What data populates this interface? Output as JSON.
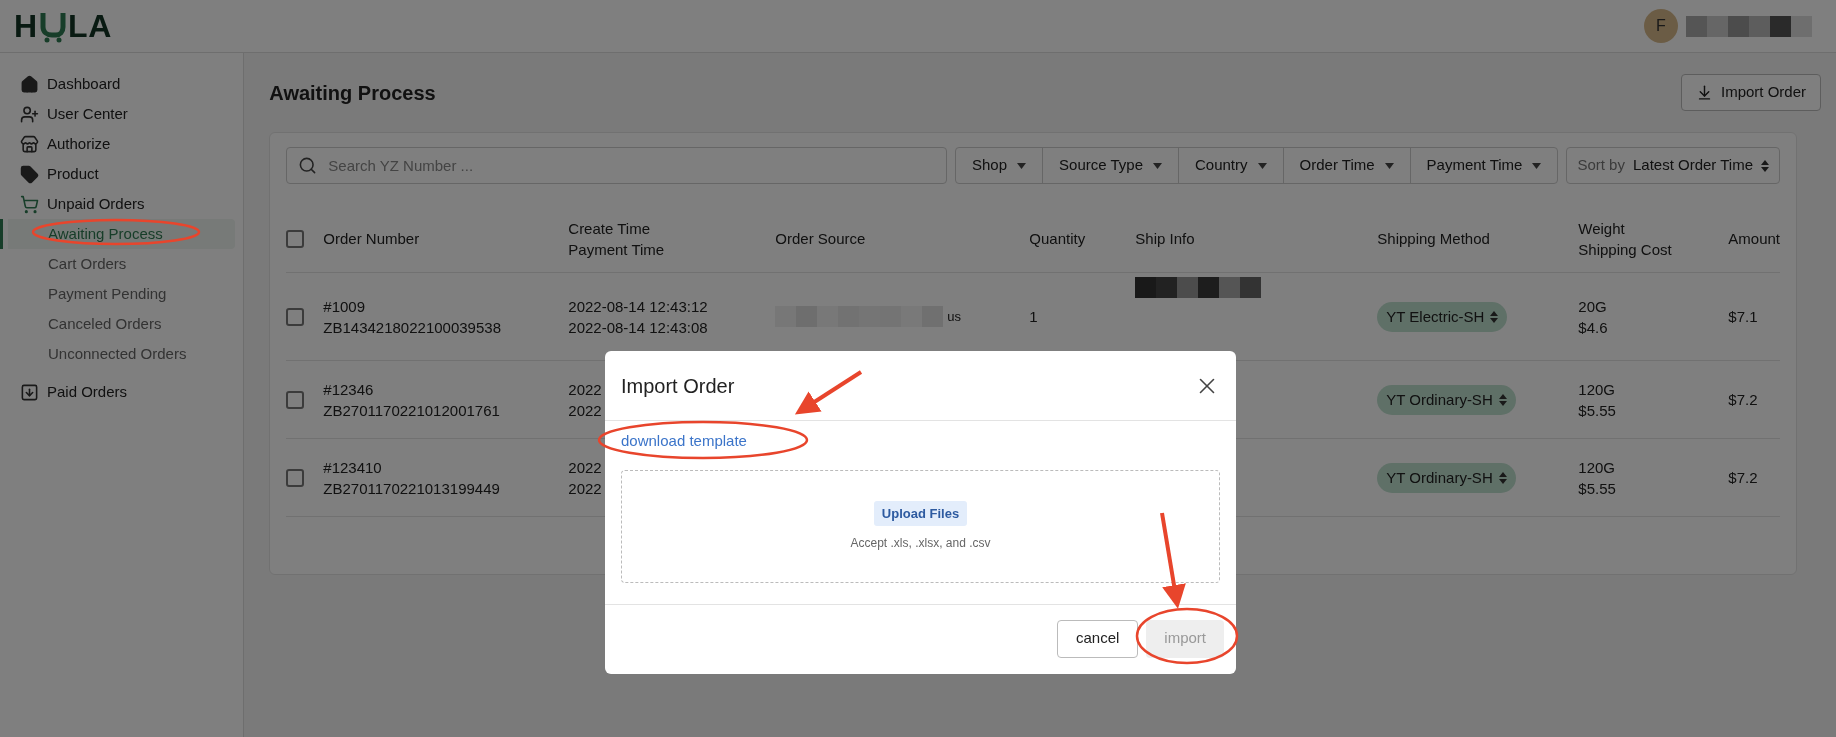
{
  "header": {
    "logo": {
      "left": "H",
      "right": "LA"
    },
    "avatar_initial": "F"
  },
  "sidebar": {
    "items": [
      {
        "label": "Dashboard",
        "selected": false
      },
      {
        "label": "User Center",
        "selected": false
      },
      {
        "label": "Authorize",
        "selected": false
      },
      {
        "label": "Product",
        "selected": false
      },
      {
        "label": "Unpaid Orders",
        "selected": false,
        "children": [
          {
            "label": "Awaiting Process",
            "selected": true
          },
          {
            "label": "Cart Orders",
            "selected": false
          },
          {
            "label": "Payment Pending",
            "selected": false
          },
          {
            "label": "Canceled Orders",
            "selected": false
          },
          {
            "label": "Unconnected Orders",
            "selected": false
          }
        ]
      },
      {
        "label": "Paid Orders",
        "selected": false
      }
    ]
  },
  "page": {
    "title": "Awaiting Process",
    "import_button": "Import Order"
  },
  "search": {
    "placeholder": "Search YZ Number ..."
  },
  "filters": [
    "Shop",
    "Source Type",
    "Country",
    "Order Time",
    "Payment Time"
  ],
  "sort": {
    "prefix": "Sort by",
    "value": "Latest Order Time"
  },
  "table": {
    "select_all_checked": false,
    "columns": [
      [
        "Order Number"
      ],
      [
        "Create Time",
        "Payment Time"
      ],
      [
        "Order Source"
      ],
      [
        "Quantity"
      ],
      [
        "Ship Info"
      ],
      [
        "Shipping Method"
      ],
      [
        "Weight",
        "Shipping Cost"
      ],
      [
        "Amount"
      ]
    ],
    "rows": [
      {
        "checked": false,
        "order_number": "#1009",
        "order_id": "ZB1434218022100039538",
        "create_time": "2022-08-14 12:43:12",
        "payment_time": "2022-08-14 12:43:08",
        "order_source": "us",
        "quantity": "1",
        "shipping_method": "YT Electric-SH",
        "weight": "20G",
        "shipping_cost": "$4.6",
        "amount": "$7.1"
      },
      {
        "checked": false,
        "order_number": "#12346",
        "order_id": "ZB2701170221012001761",
        "create_time": "2022",
        "payment_time": "2022",
        "shipping_method": "YT Ordinary-SH",
        "weight": "120G",
        "shipping_cost": "$5.55",
        "amount": "$7.2"
      },
      {
        "checked": false,
        "order_number": "#123410",
        "order_id": "ZB2701170221013199449",
        "create_time": "2022",
        "payment_time": "2022",
        "shipping_method": "YT Ordinary-SH",
        "weight": "120G",
        "shipping_cost": "$5.55",
        "amount": "$7.2"
      }
    ]
  },
  "modal": {
    "title": "Import Order",
    "link": "download template",
    "upload_button": "Upload Files",
    "accept_text": "Accept .xls, .xlsx, and .csv",
    "buttons": [
      {
        "label": "cancel",
        "disabled": false
      },
      {
        "label": "import",
        "disabled": true
      }
    ]
  }
}
